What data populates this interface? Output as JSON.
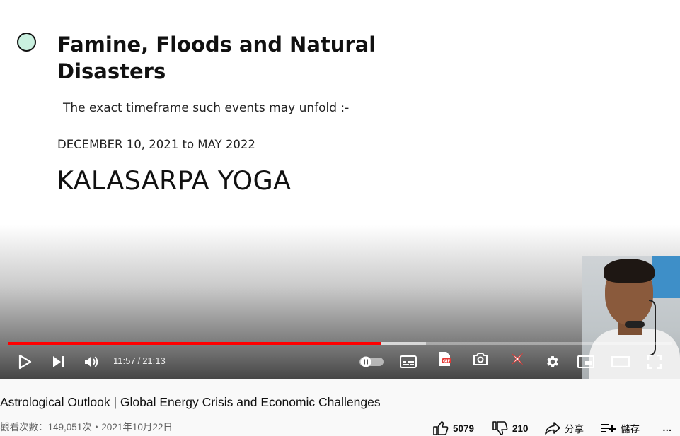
{
  "slide": {
    "title": "Famine, Floods and Natural Disasters",
    "subtitle": "The exact timeframe such events may unfold :-",
    "dates": "DECEMBER 10, 2021 to MAY 2022",
    "heading": "KALASARPA YOGA",
    "bullet_color": "#c9f0df"
  },
  "player": {
    "current_time": "11:57",
    "separator": "/",
    "duration": "21:13",
    "played_fraction": 0.563,
    "loaded_fraction": 0.63,
    "progress_color": "#ff0000",
    "icons": [
      "play-icon",
      "next-icon",
      "volume-icon",
      "autoplay-toggle-icon",
      "subtitles-icon",
      "gif-icon",
      "screenshot-icon",
      "extension-icon",
      "settings-icon",
      "miniplayer-icon",
      "theater-icon",
      "fullscreen-icon"
    ]
  },
  "video": {
    "title": "Astrological Outlook | Global Energy Crisis and Economic Challenges",
    "views_date": "觀看次數：149,051次・2021年10月22日",
    "likes": "5079",
    "dislikes": "210",
    "share_label": "分享",
    "save_label": "儲存",
    "more_label": "…"
  }
}
